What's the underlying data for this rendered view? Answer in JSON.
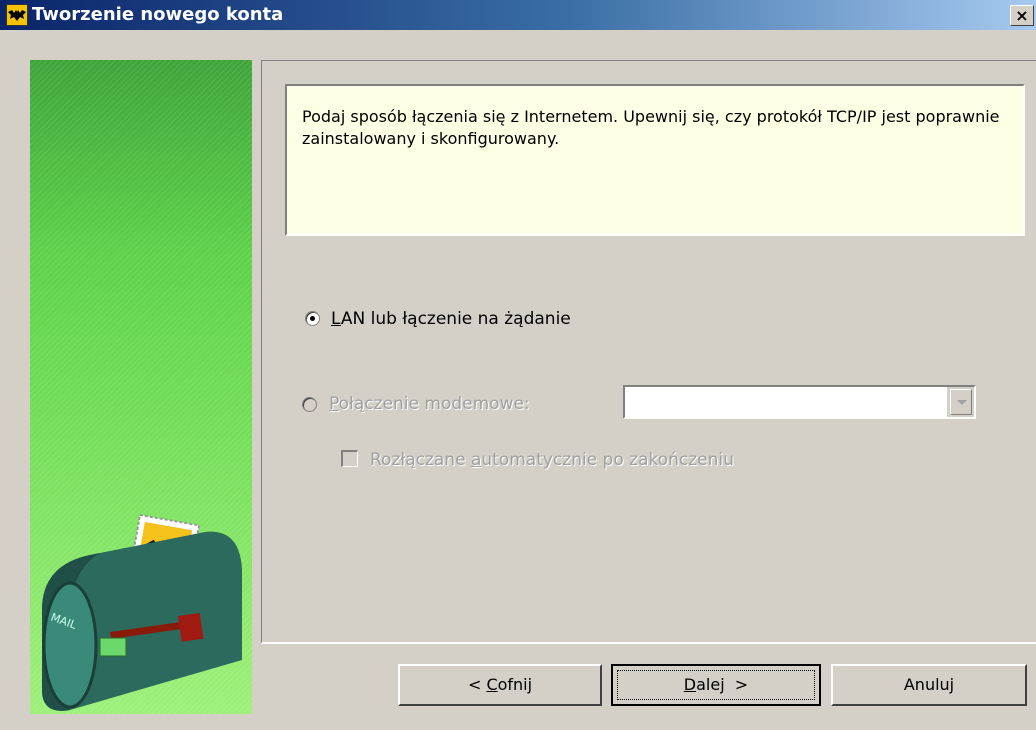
{
  "window": {
    "title": "Tworzenie nowego konta",
    "close_label": "×"
  },
  "side_image": {
    "icon": "mailbox-with-bat-stamp",
    "mailbox_text": "MAIL"
  },
  "info": {
    "text": "Podaj sposób łączenia się z Internetem. Upewnij się, czy protokół TCP/IP jest poprawnie zainstalowany i skonfigurowany."
  },
  "options": {
    "lan": {
      "mnemonic": "L",
      "rest": "AN lub łączenie na żądanie",
      "selected": true
    },
    "modem": {
      "mnemonic": "P",
      "rest": "ołączenie modemowe:",
      "selected": false,
      "enabled": false
    },
    "modem_combo_value": "",
    "auto_disconnect": {
      "before": "Rozłączane ",
      "mnemonic": "a",
      "after": "utomatycznie po zakończeniu",
      "checked": false,
      "enabled": false
    }
  },
  "buttons": {
    "back": {
      "before": "< ",
      "mnemonic": "C",
      "after": "ofnij"
    },
    "next": {
      "mnemonic": "D",
      "after": "alej  >"
    },
    "cancel": {
      "label": "Anuluj"
    }
  },
  "colors": {
    "title_start": "#0a246a",
    "title_end": "#a6caf0",
    "dialog_bg": "#d4d0c8",
    "info_bg": "#ffffe6",
    "side_green": "#5fd24a"
  }
}
